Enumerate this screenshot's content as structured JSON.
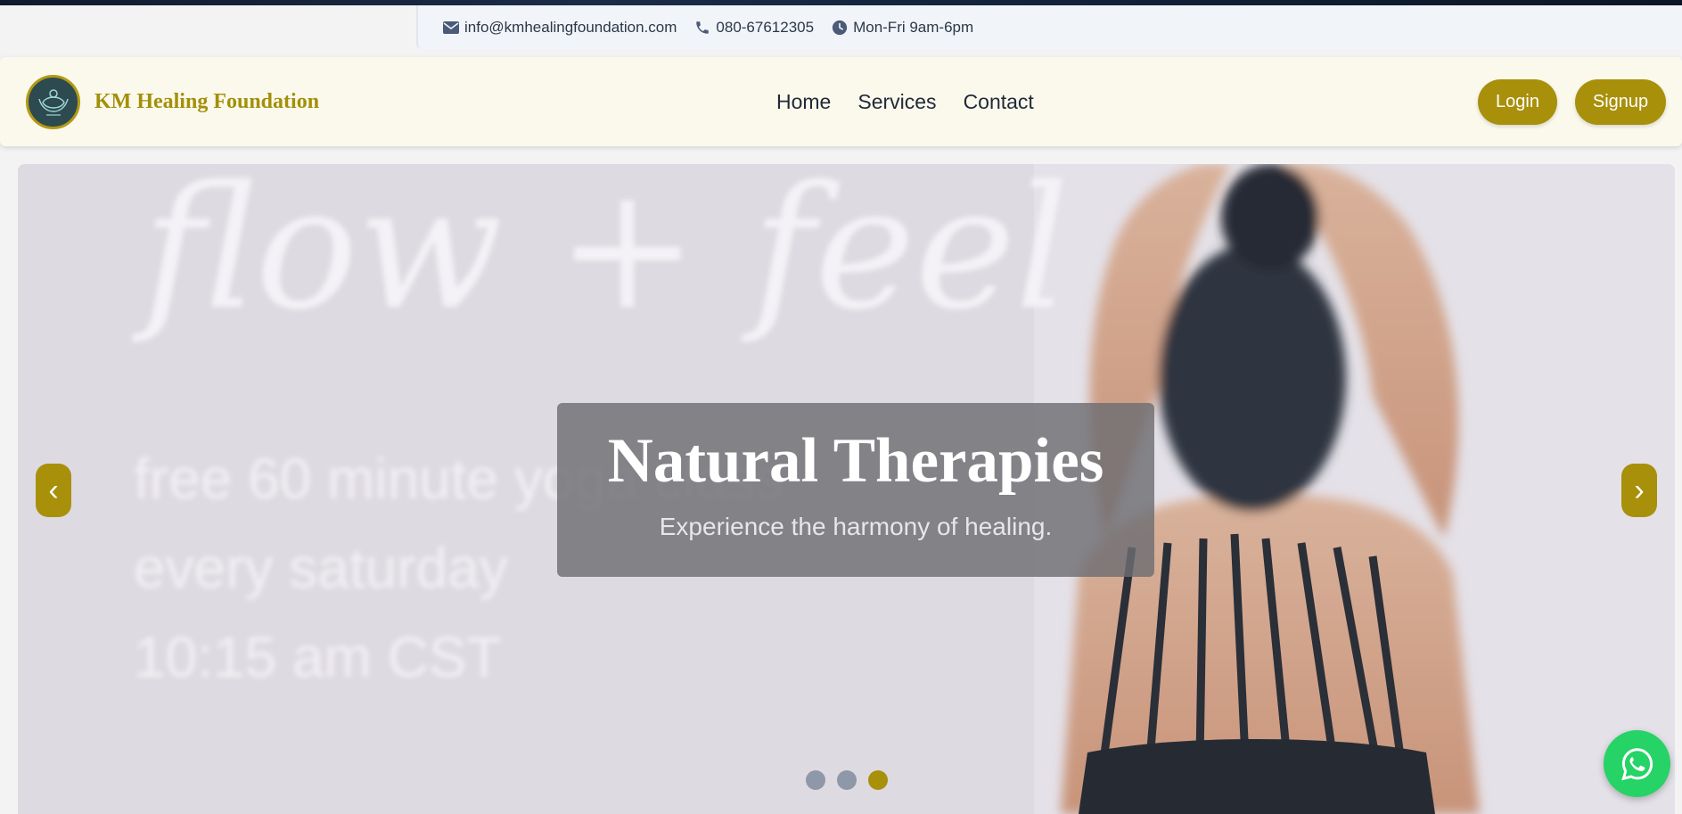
{
  "contact_bar": {
    "email": "info@kmhealingfoundation.com",
    "phone": "080-67612305",
    "hours": "Mon-Fri 9am-6pm",
    "icons": [
      "envelope-icon",
      "phone-icon",
      "clock-icon"
    ]
  },
  "navbar": {
    "brand": "KM Healing Foundation",
    "links": [
      "Home",
      "Services",
      "Contact"
    ],
    "login_label": "Login",
    "signup_label": "Signup"
  },
  "hero": {
    "background_text": [
      "flow + feel",
      "free 60 minute yoga class",
      "every saturday",
      "10:15 am CST"
    ],
    "title": "Natural Therapies",
    "subtitle": "Experience the harmony of healing.",
    "prev_label": "‹",
    "next_label": "›",
    "slide_count": 3,
    "active_slide": 3
  },
  "colors": {
    "accent": "#a8900b",
    "navbar_bg": "#fbf9ec",
    "whatsapp": "#25d366"
  }
}
